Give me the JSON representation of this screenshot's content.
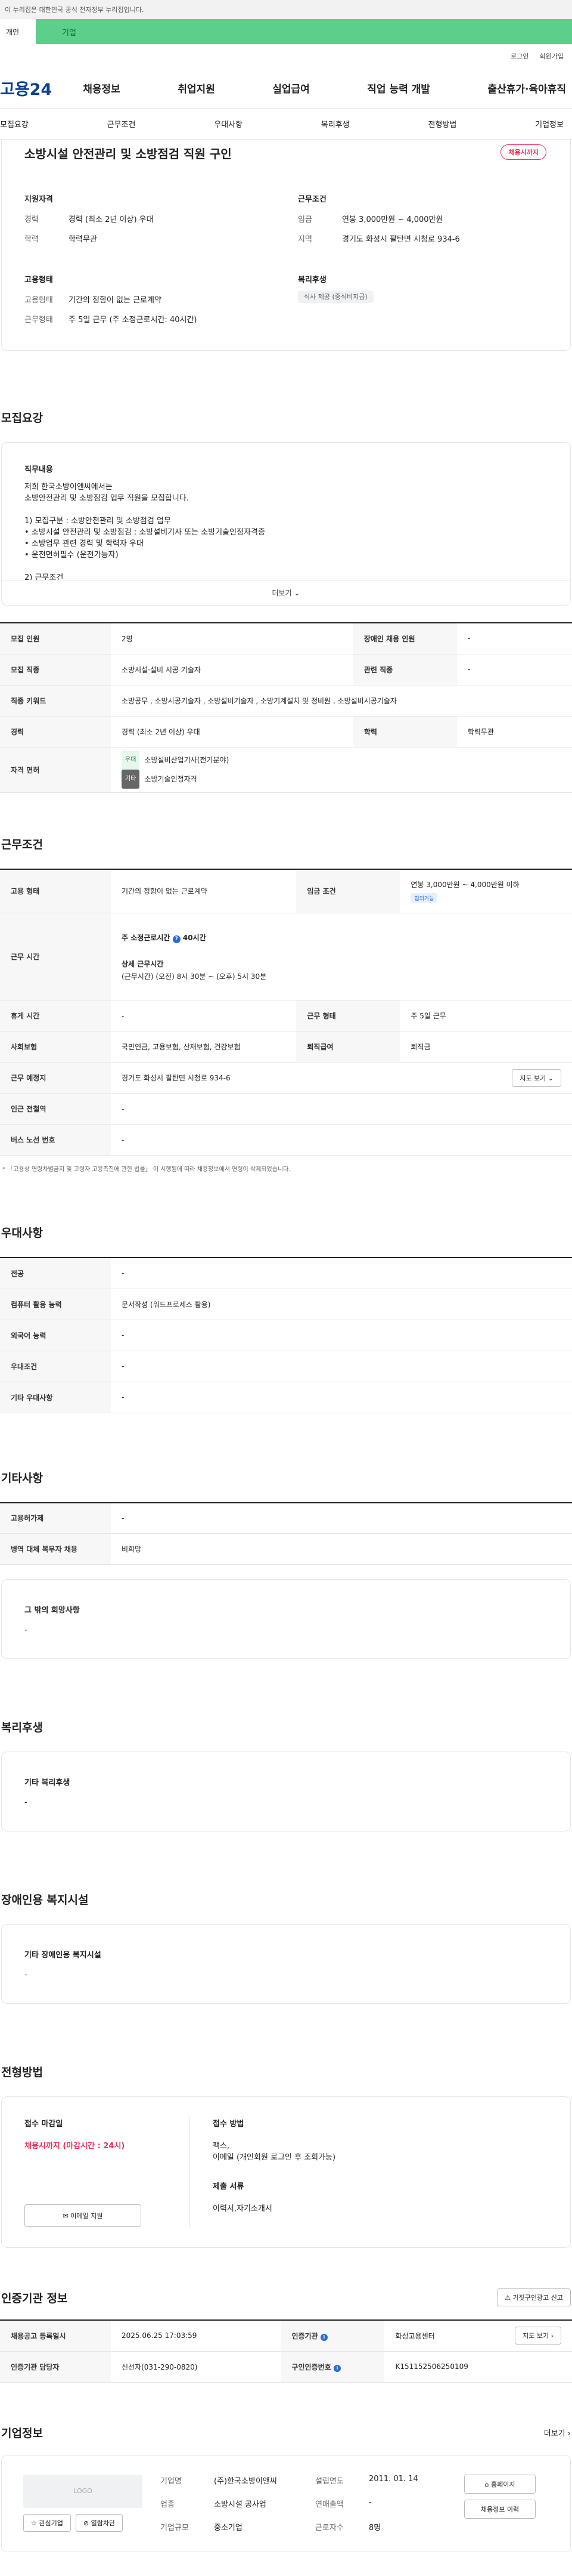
{
  "gov_notice": "이 누리집은 대한민국 공식 전자정부 누리집입니다.",
  "service_switch": {
    "individual": "개인",
    "corporate": "기업"
  },
  "util_links": [
    "로그인",
    "회원가입"
  ],
  "logo": "고용24",
  "gnb": [
    "채용정보",
    "취업지원",
    "실업급여",
    "직업 능력 개발",
    "출산휴가·육아휴직"
  ],
  "anchor_tabs": [
    "모집요강",
    "근무조건",
    "우대사항",
    "복리후생",
    "전형방법",
    "기업정보"
  ],
  "title": {
    "job_title": "소방시설 안전관리 및 소방점검 직원 구인",
    "status_badge": "채용시까지"
  },
  "summary": {
    "qualification": {
      "title": "지원자격",
      "rows": [
        {
          "k": "경력",
          "v": "경력 (최소 2년 이상) 우대"
        },
        {
          "k": "학력",
          "v": "학력무관"
        }
      ]
    },
    "conditions": {
      "title": "근무조건",
      "rows": [
        {
          "k": "임금",
          "v": "연봉 3,000만원 ~ 4,000만원"
        },
        {
          "k": "지역",
          "v": "경기도 화성시 팔탄면 시청로 934-6"
        }
      ]
    },
    "employment": {
      "title": "고용형태",
      "rows": [
        {
          "k": "고용형태",
          "v": "기간의 정함이 없는 근로계약"
        },
        {
          "k": "근무형태",
          "v": "주 5일 근무 (주 소정근로시간: 40시간)"
        }
      ]
    },
    "welfare": {
      "title": "복리후생",
      "tag": "식사 제공 (중식비지급)"
    }
  },
  "recruit_section": {
    "title": "모집요강"
  },
  "job_content": {
    "title": "직무내용",
    "lines": [
      "저희 한국소방이앤씨에서는",
      "소방안전관리 및 소방점검 업무 직원을 모집합니다.",
      "",
      "1) 모집구분 : 소방안전관리 및  소방점검 업무",
      "• 소방시설 안전관리 및 소방점검 : 소방설비기사 또는 소방기술인정자격증",
      "• 소방업무 관련 경력 및 학력자 우대",
      "• 운전면허필수 (운전가능자)",
      "",
      "2) 근무조건"
    ],
    "more": "더보기"
  },
  "recruit_table": {
    "headcount_label": "모집 인원",
    "headcount": "2명",
    "disabled_label": "장애인 채용 인원",
    "disabled": "-",
    "job_label": "모집 직종",
    "job": "소방시설·설비 시공 기술자",
    "related_label": "관련 직종",
    "related": "-",
    "keyword_label": "직종 키워드",
    "keyword": "소방공무 , 소방시공기술자 , 소방설비기술자 , 소방기계설치 및 정비원 , 소방설비시공기술자",
    "career_label": "경력",
    "career": "경력 (최소 2년 이상) 우대",
    "edu_label": "학력",
    "edu": "학력무관",
    "license_label": "자격 면허",
    "licenses": [
      {
        "tag": "우대",
        "name": "소방설비산업기사(전기분야)"
      },
      {
        "tag": "기타",
        "name": "소방기술인정자격"
      }
    ]
  },
  "work_section": {
    "title": "근무조건"
  },
  "work_table": {
    "type_label": "고용 형태",
    "type": "기간의 정함이 없는 근로계약",
    "wage_label": "임금 조건",
    "wage": "연봉 3,000만원 ~ 4,000만원 이하",
    "wage_badge": "협의가능",
    "hours_label": "근무 시간",
    "hours_weekly": "주 소정근로시간",
    "hours_weekly_value": "40시간",
    "hours_detail_title": "상세 근무시간",
    "hours_detail": "(근무시간) (오전) 8시 30분 ~ (오후) 5시 30분",
    "holiday_label": "휴게 시간",
    "holiday": "-",
    "worktype_label": "근무 형태",
    "worktype": "주 5일 근무",
    "insurance_label": "사회보험",
    "insurance": "국민연금, 고용보험, 산재보험, 건강보험",
    "retire_label": "퇴직급여",
    "retire": "퇴직금",
    "place_label": "근무 예정지",
    "place": "경기도 화성시 팔탄면 시청로 934-6",
    "map_btn": "지도 보기",
    "station_label": "인근 전철역",
    "station": "-",
    "bus_label": "버스 노선 번호",
    "bus": "-",
    "note": "* 「고용상 연령차별금지 및 고령자 고용촉진에 관한 법률」 이 시행됨에 따라 채용정보에서 연령이 삭제되었습니다."
  },
  "pref_section": {
    "title": "우대사항"
  },
  "pref_table": [
    {
      "k": "전공",
      "v": "-"
    },
    {
      "k": "컴퓨터 활용 능력",
      "v": "문서작성 (워드프로세스 활용)"
    },
    {
      "k": "외국어 능력",
      "v": "-"
    },
    {
      "k": "우대조건",
      "v": "-"
    },
    {
      "k": "기타 우대사항",
      "v": "-"
    }
  ],
  "etc_section": {
    "title": "기타사항"
  },
  "etc_table": [
    {
      "k": "고용허가제",
      "v": "-"
    },
    {
      "k": "병역 대체 복무자 채용",
      "v": "비희망"
    }
  ],
  "etc_other": {
    "title": "그 밖의 희망사항",
    "value": "-"
  },
  "welfare_section": {
    "title": "복리후생",
    "sub": "기타 복리후생",
    "value": "-"
  },
  "disabled_section": {
    "title": "장애인용 복지시설",
    "sub": "기타 장애인용 복지시설",
    "value": "-"
  },
  "apply_section": {
    "title": "전형방법",
    "deadline_label": "접수 마감일",
    "deadline": "채용시까지 (마감시간 : 24시)",
    "apply_btn": "이메일 지원",
    "method_label": "접수 방법",
    "method": [
      "팩스,",
      "이메일 (개인회원 로그인 후 조회가능)"
    ],
    "docs_label": "제출 서류",
    "docs": "이력서,자기소개서"
  },
  "cert_section": {
    "title": "인증기관 정보",
    "report_btn": "거짓구인광고 신고",
    "reg_label": "채용공고 등록일시",
    "reg": "2025.06.25 17:03:59",
    "org_label": "인증기관",
    "org": "화성고용센터",
    "map_btn": "지도 보기",
    "mgr_label": "인증기관 담당자",
    "mgr": "신선자(031-290-0820)",
    "num_label": "구인인증번호",
    "num": "K151152506250109"
  },
  "company_section": {
    "title": "기업정보",
    "more": "더보기",
    "logo_ph": "LOGO",
    "fav_btn": "관심기업",
    "block_btn": "열람차단",
    "name_label": "기업명",
    "name": "(주)한국소방이앤씨",
    "founded_label": "설립연도",
    "founded": "2011. 01. 14",
    "sector_label": "업종",
    "sector": "소방시설 공사업",
    "sales_label": "연매출액",
    "sales": "-",
    "size_label": "기업규모",
    "size": "중소기업",
    "emp_label": "근로자수",
    "emp": "8명",
    "homepage_btn": "홈페이지",
    "jobs_btn": "채용정보 이력"
  }
}
